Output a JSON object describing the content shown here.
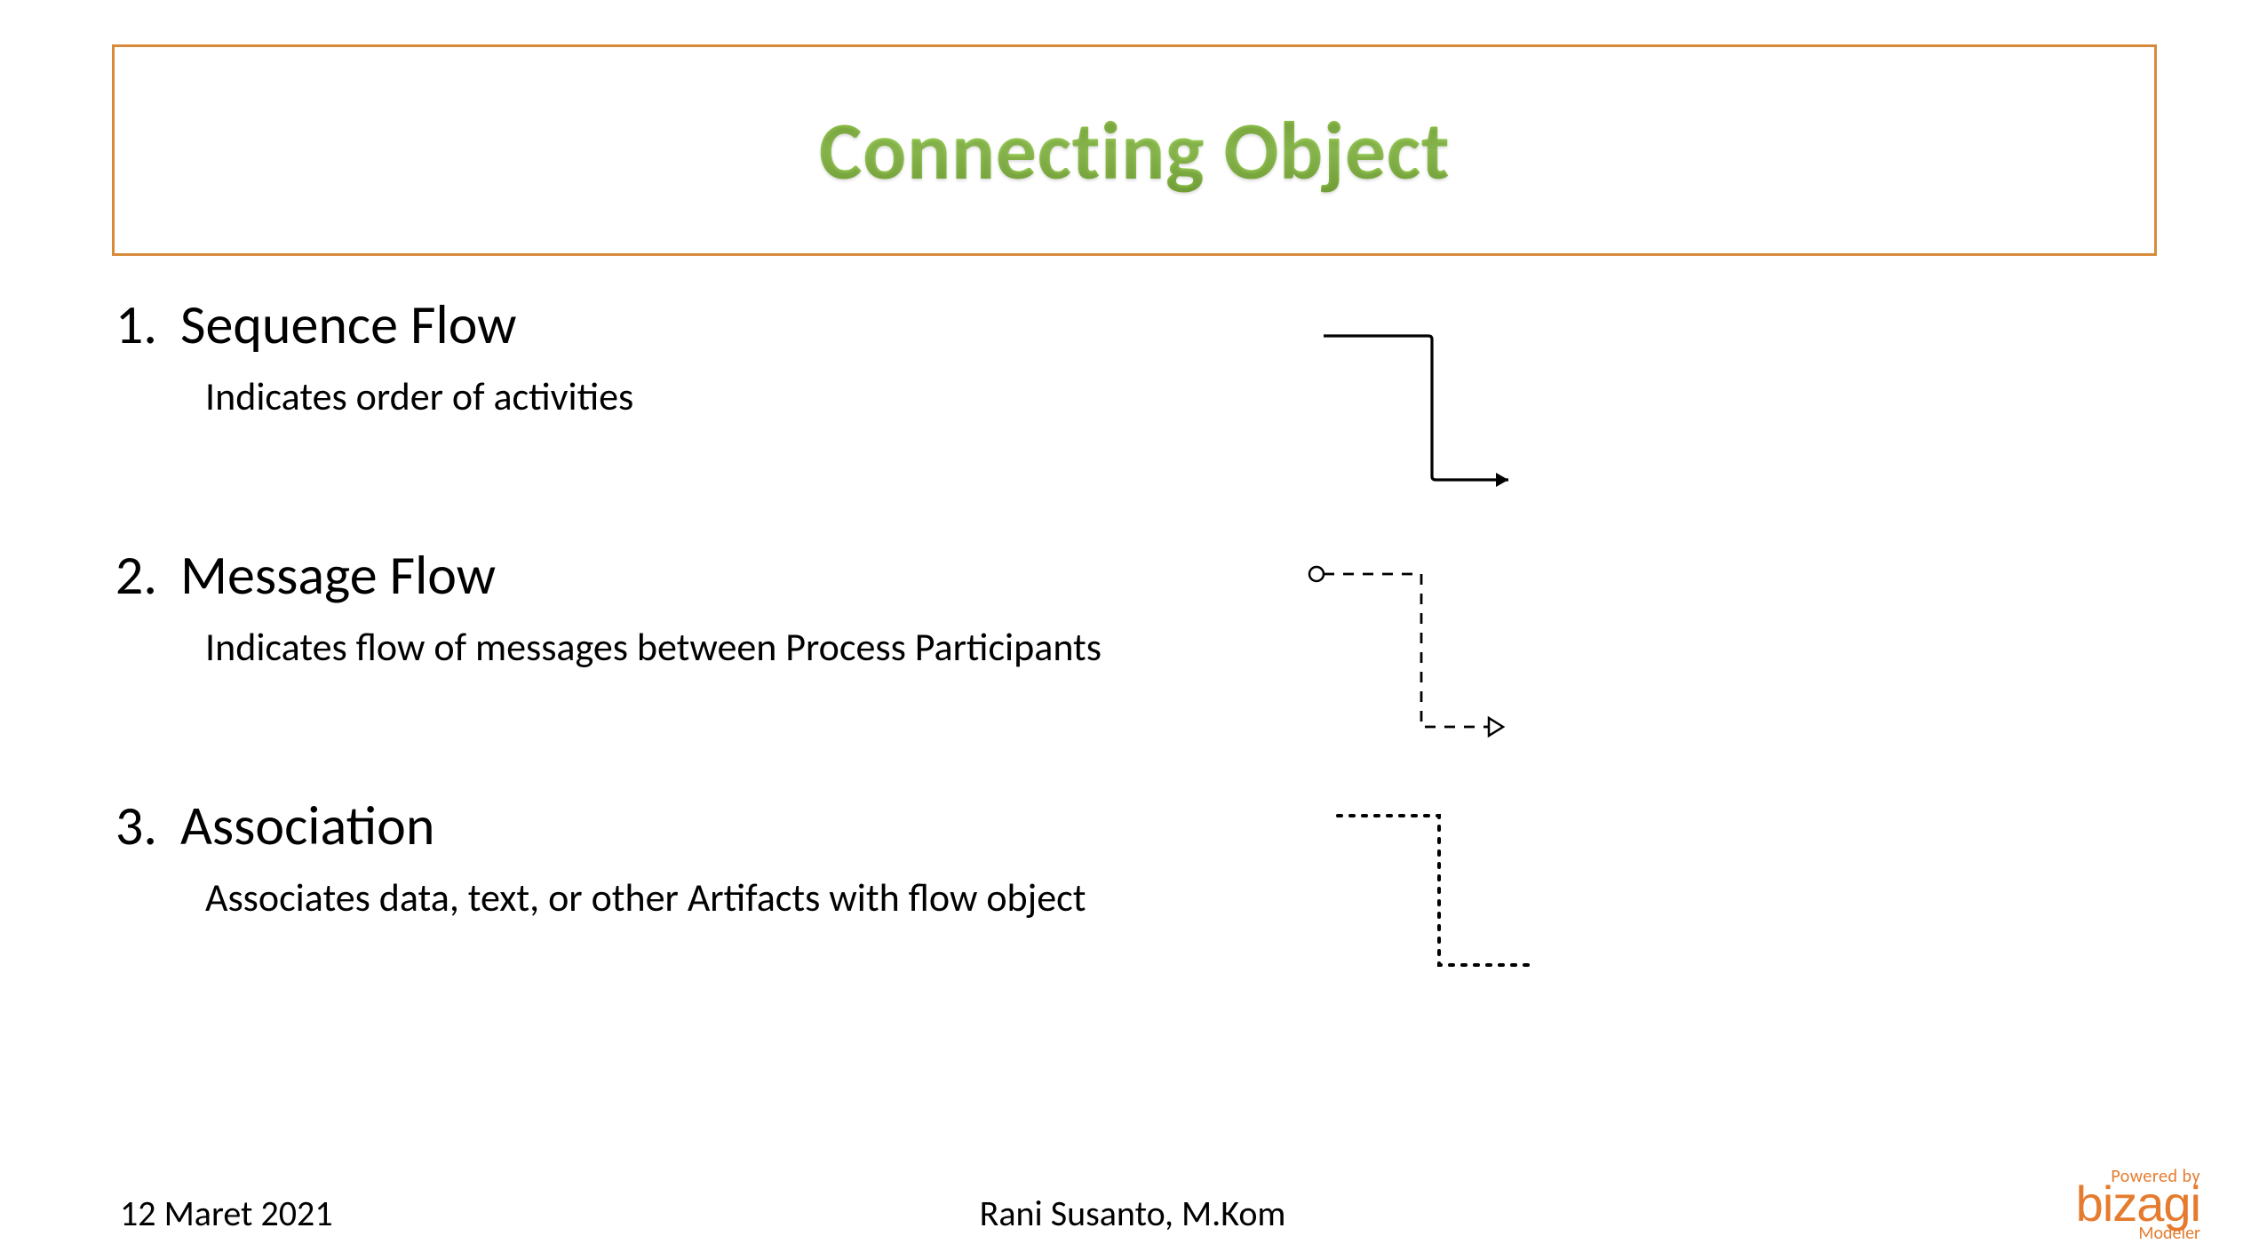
{
  "title": "Connecting Object",
  "items": [
    {
      "name": "Sequence Flow",
      "desc": "Indicates order of activities"
    },
    {
      "name": "Message Flow",
      "desc": "Indicates flow of messages between Process Participants"
    },
    {
      "name": "Association",
      "desc": "Associates data, text, or other Artifacts with flow object"
    }
  ],
  "footer": {
    "date": "12 Maret 2021",
    "author": "Rani Susanto, M.Kom"
  },
  "logo": {
    "poweredby": "Powered by",
    "brand": "bizagi",
    "sub": "Modeler"
  }
}
